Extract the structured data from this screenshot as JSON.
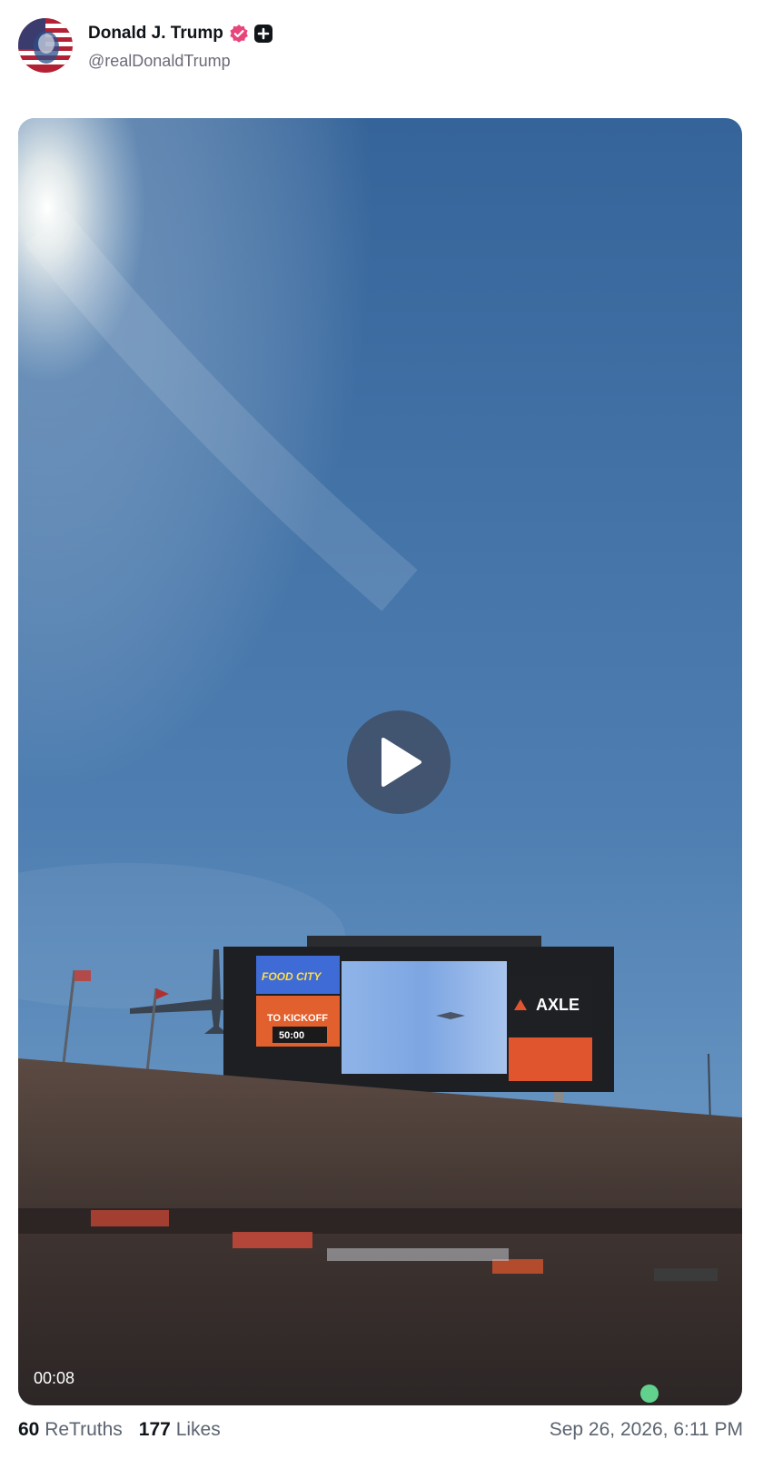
{
  "author": {
    "display_name": "Donald J. Trump",
    "handle": "@realDonaldTrump",
    "avatar": "flag-portrait-avatar",
    "verified_icon": "verified-badge-icon",
    "verified_color": "#e8457a",
    "plus_icon": "plus-badge-icon"
  },
  "media": {
    "type": "video",
    "duration": "00:08",
    "play_icon": "play-icon",
    "scoreboard": {
      "left_panel_top": "FOOD CITY",
      "left_panel_mid": "TO KICKOFF",
      "clock": "50:00",
      "right_brand": "AXLE"
    }
  },
  "stats": {
    "retruths_count": "60",
    "retruths_label": "ReTruths",
    "likes_count": "177",
    "likes_label": "Likes"
  },
  "timestamp": "Sep 26, 2026, 6:11 PM",
  "colors": {
    "sky_top": "#2f5f95",
    "sky_bottom": "#6f9ec9",
    "crowd": "#4a3a34",
    "play_overlay": "#404c62"
  }
}
